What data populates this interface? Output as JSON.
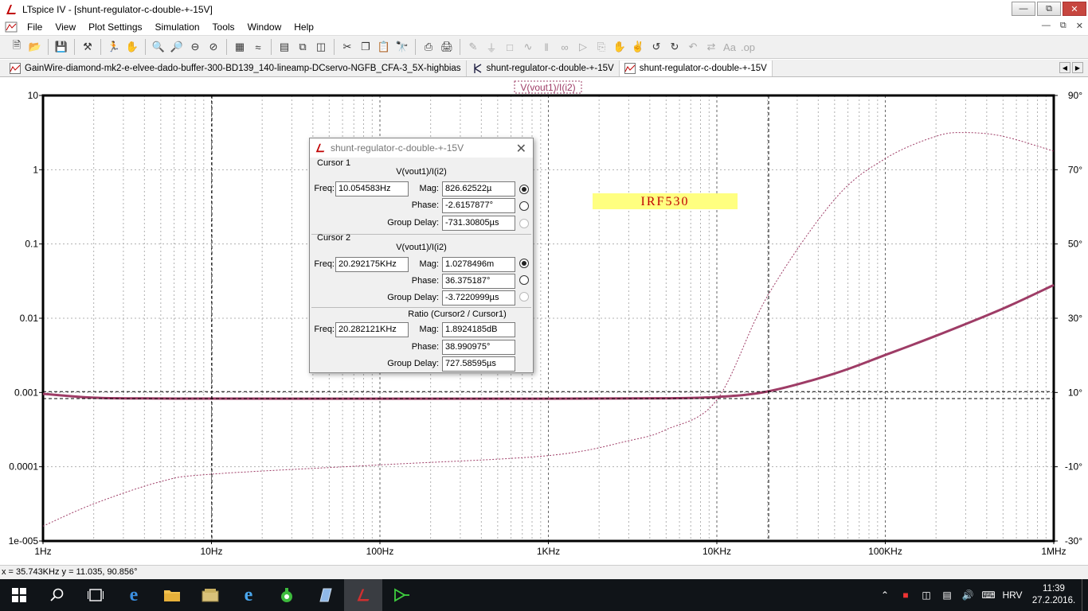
{
  "window": {
    "title": "LTspice IV - [shunt-regulator-c-double-+-15V]"
  },
  "menu": [
    "File",
    "View",
    "Plot Settings",
    "Simulation",
    "Tools",
    "Window",
    "Help"
  ],
  "tabs": [
    {
      "label": "GainWire-diamond-mk2-e-elvee-dado-buffer-300-BD139_140-lineamp-DCservo-NGFB_CFA-3_5X-highbias"
    },
    {
      "label": "shunt-regulator-c-double-+-15V"
    },
    {
      "label": "shunt-regulator-c-double-+-15V"
    }
  ],
  "plot": {
    "trace_label": "V(vout1)/I(i2)",
    "annotation": "IRF530",
    "left_ticks": [
      "10",
      "1",
      "0.1",
      "0.01",
      "0.001",
      "0.0001",
      "1e-005"
    ],
    "right_ticks": [
      "90°",
      "70°",
      "50°",
      "30°",
      "10°",
      "-10°",
      "-30°"
    ],
    "x_ticks": [
      "1Hz",
      "10Hz",
      "100Hz",
      "1KHz",
      "10KHz",
      "100KHz",
      "1MHz"
    ],
    "colors": {
      "trace": "#9e3c66",
      "grid": "#b0b0b0",
      "annotation_bg": "#ffff80",
      "annotation_text": "#c00000"
    }
  },
  "chart_data": {
    "type": "line",
    "title": "V(vout1)/I(i2)",
    "xlabel": "",
    "ylabel": "",
    "x_scale": "log",
    "y_scale": "log",
    "xlim": [
      1,
      1000000
    ],
    "ylim": [
      1e-05,
      10
    ],
    "y2lim": [
      -30,
      90
    ],
    "grid": true,
    "series": [
      {
        "axis": "magnitude",
        "style": "solid",
        "x": [
          1,
          2,
          5,
          10,
          100,
          1000,
          5000,
          10000,
          20000,
          50000,
          100000,
          200000,
          500000,
          1000000
        ],
        "y": [
          0.00096,
          0.00085,
          0.00083,
          0.000827,
          0.000826,
          0.000826,
          0.000835,
          0.00087,
          0.00103,
          0.0018,
          0.0032,
          0.0058,
          0.0135,
          0.028
        ]
      },
      {
        "axis": "phase",
        "style": "dotted",
        "x": [
          1,
          2,
          5,
          10,
          100,
          1000,
          3000,
          5000,
          10000,
          20000,
          50000,
          100000,
          200000,
          300000,
          500000,
          1000000
        ],
        "y": [
          -26,
          -20,
          -14,
          -12,
          -9.5,
          -7,
          -3,
          0,
          8,
          36,
          62,
          73,
          79,
          80,
          79,
          75
        ]
      }
    ]
  },
  "dialog": {
    "title": "shunt-regulator-c-double-+-15V",
    "cursor1": {
      "header": "Cursor 1",
      "expr": "V(vout1)/I(i2)",
      "freq_label": "Freq:",
      "freq": "10.054583Hz",
      "mag_label": "Mag:",
      "mag": "826.62522µ",
      "phase_label": "Phase:",
      "phase": "-2.6157877°",
      "gd_label": "Group Delay:",
      "gd": "-731.30805µs"
    },
    "cursor2": {
      "header": "Cursor 2",
      "expr": "V(vout1)/I(i2)",
      "freq_label": "Freq:",
      "freq": "20.292175KHz",
      "mag_label": "Mag:",
      "mag": "1.0278496m",
      "phase_label": "Phase:",
      "phase": "36.375187°",
      "gd_label": "Group Delay:",
      "gd": "-3.7220999µs"
    },
    "ratio": {
      "header": "Ratio (Cursor2 / Cursor1)",
      "freq_label": "Freq:",
      "freq": "20.282121KHz",
      "mag_label": "Mag:",
      "mag": "1.8924185dB",
      "phase_label": "Phase:",
      "phase": "38.990975°",
      "gd_label": "Group Delay:",
      "gd": "727.58595µs"
    }
  },
  "status": {
    "text": "x = 35.743KHz   y = 11.035, 90.856°"
  },
  "taskbar": {
    "lang": "HRV",
    "time": "11:39",
    "date": "27.2.2016."
  }
}
